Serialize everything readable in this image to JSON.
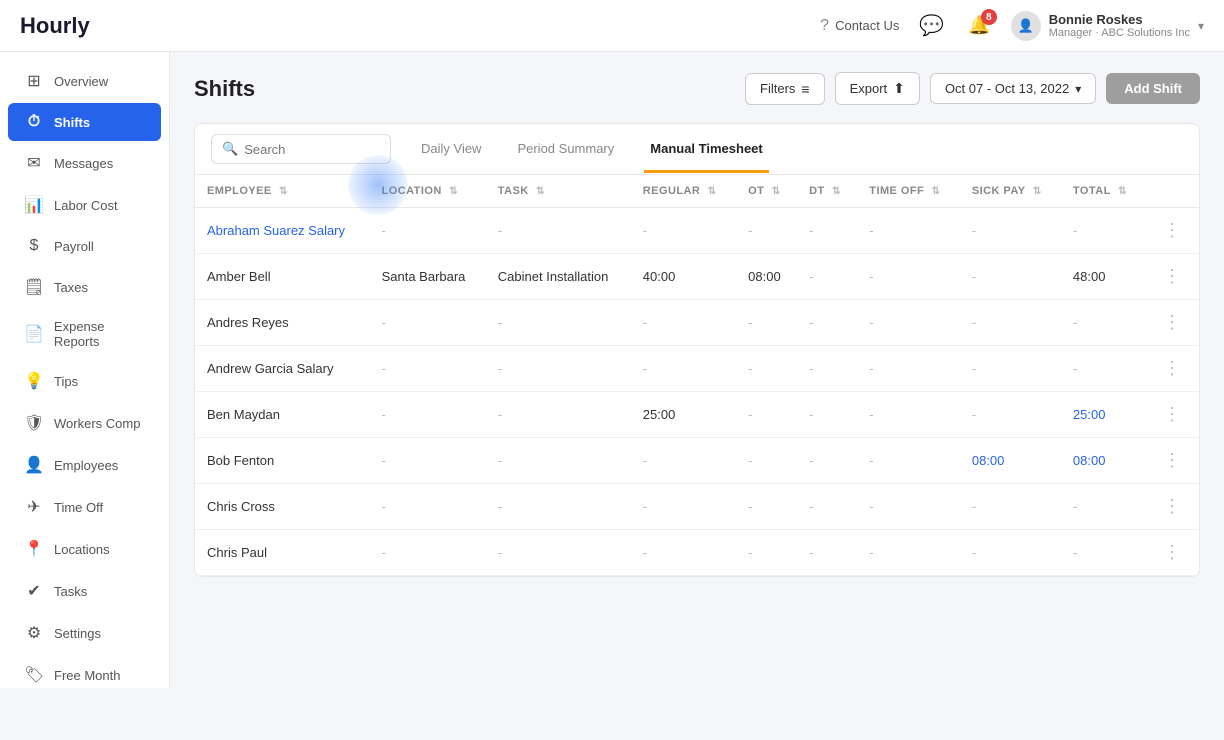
{
  "app": {
    "logo": "Hourly"
  },
  "topnav": {
    "contact_us": "Contact Us",
    "notification_count": "8",
    "user_name": "Bonnie Roskes",
    "user_role": "Manager · ABC Solutions Inc",
    "chevron": "▾"
  },
  "sidebar": {
    "items": [
      {
        "id": "overview",
        "label": "Overview",
        "icon": "⊞",
        "active": false
      },
      {
        "id": "shifts",
        "label": "Shifts",
        "icon": "⏱",
        "active": true
      },
      {
        "id": "messages",
        "label": "Messages",
        "icon": "✉",
        "active": false
      },
      {
        "id": "labor-cost",
        "label": "Labor Cost",
        "icon": "📊",
        "active": false
      },
      {
        "id": "payroll",
        "label": "Payroll",
        "icon": "$",
        "active": false
      },
      {
        "id": "taxes",
        "label": "Taxes",
        "icon": "🗒",
        "active": false
      },
      {
        "id": "expense-reports",
        "label": "Expense Reports",
        "icon": "📄",
        "active": false
      },
      {
        "id": "tips",
        "label": "Tips",
        "icon": "💡",
        "active": false
      },
      {
        "id": "workers-comp",
        "label": "Workers Comp",
        "icon": "🛡",
        "active": false
      },
      {
        "id": "employees",
        "label": "Employees",
        "icon": "👤",
        "active": false
      },
      {
        "id": "time-off",
        "label": "Time Off",
        "icon": "✈",
        "active": false
      },
      {
        "id": "locations",
        "label": "Locations",
        "icon": "📍",
        "active": false
      },
      {
        "id": "tasks",
        "label": "Tasks",
        "icon": "✔",
        "active": false
      },
      {
        "id": "settings",
        "label": "Settings",
        "icon": "⚙",
        "active": false
      },
      {
        "id": "free-month",
        "label": "Free Month",
        "icon": "🏷",
        "active": false
      }
    ]
  },
  "shifts": {
    "title": "Shifts",
    "filters_label": "Filters",
    "export_label": "Export",
    "date_range": "Oct 07 - Oct 13, 2022",
    "add_shift_label": "Add Shift",
    "search_placeholder": "Search",
    "tabs": [
      {
        "id": "daily",
        "label": "Daily View",
        "active": false
      },
      {
        "id": "period",
        "label": "Period Summary",
        "active": false
      },
      {
        "id": "manual",
        "label": "Manual Timesheet",
        "active": true
      }
    ],
    "columns": [
      {
        "id": "employee",
        "label": "Employee"
      },
      {
        "id": "location",
        "label": "Location"
      },
      {
        "id": "task",
        "label": "Task"
      },
      {
        "id": "regular",
        "label": "Regular"
      },
      {
        "id": "ot",
        "label": "OT"
      },
      {
        "id": "dt",
        "label": "DT"
      },
      {
        "id": "time_off",
        "label": "Time Off"
      },
      {
        "id": "sick_pay",
        "label": "Sick Pay"
      },
      {
        "id": "total",
        "label": "Total"
      }
    ],
    "rows": [
      {
        "employee": "Abraham Suarez Salary",
        "location": "-",
        "task": "-",
        "regular": "-",
        "ot": "-",
        "dt": "-",
        "time_off": "-",
        "sick_pay": "-",
        "total": "-",
        "emp_link": true
      },
      {
        "employee": "Amber Bell",
        "location": "Santa Barbara",
        "task": "Cabinet Installation",
        "regular": "40:00",
        "ot": "08:00",
        "dt": "-",
        "time_off": "-",
        "sick_pay": "-",
        "total": "48:00",
        "emp_link": false
      },
      {
        "employee": "Andres Reyes",
        "location": "-",
        "task": "-",
        "regular": "-",
        "ot": "-",
        "dt": "-",
        "time_off": "-",
        "sick_pay": "-",
        "total": "-",
        "emp_link": false
      },
      {
        "employee": "Andrew Garcia Salary",
        "location": "-",
        "task": "-",
        "regular": "-",
        "ot": "-",
        "dt": "-",
        "time_off": "-",
        "sick_pay": "-",
        "total": "-",
        "emp_link": false
      },
      {
        "employee": "Ben Maydan",
        "location": "-",
        "task": "-",
        "regular": "25:00",
        "ot": "-",
        "dt": "-",
        "time_off": "-",
        "sick_pay": "-",
        "total": "25:00",
        "emp_link": false,
        "total_blue": true
      },
      {
        "employee": "Bob Fenton",
        "location": "-",
        "task": "-",
        "regular": "-",
        "ot": "-",
        "dt": "-",
        "time_off": "-",
        "sick_pay": "08:00",
        "total": "08:00",
        "emp_link": false,
        "sick_blue": true,
        "total_blue": true
      },
      {
        "employee": "Chris Cross",
        "location": "-",
        "task": "-",
        "regular": "-",
        "ot": "-",
        "dt": "-",
        "time_off": "-",
        "sick_pay": "-",
        "total": "-",
        "emp_link": false
      },
      {
        "employee": "Chris Paul",
        "location": "-",
        "task": "-",
        "regular": "-",
        "ot": "-",
        "dt": "-",
        "time_off": "-",
        "sick_pay": "-",
        "total": "-",
        "emp_link": false
      }
    ]
  }
}
